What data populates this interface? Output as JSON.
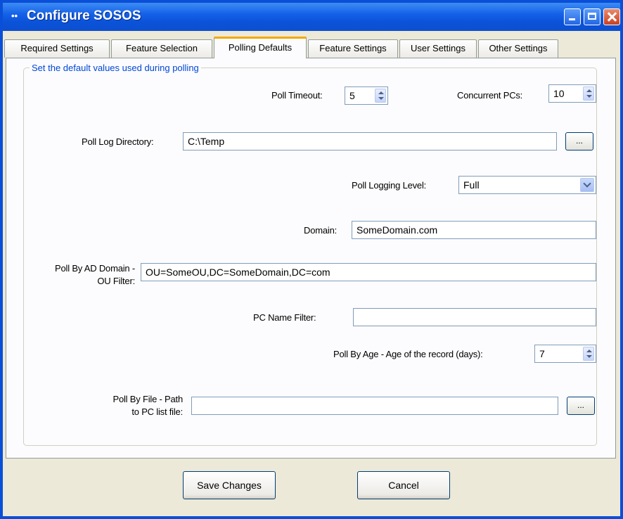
{
  "window": {
    "title": "Configure SOSOS",
    "icon": "app-icon"
  },
  "tabs": [
    {
      "label": "Required Settings"
    },
    {
      "label": "Feature Selection"
    },
    {
      "label": "Polling Defaults"
    },
    {
      "label": "Feature Settings"
    },
    {
      "label": "User Settings"
    },
    {
      "label": "Other Settings"
    }
  ],
  "active_tab": "Polling Defaults",
  "group": {
    "legend": "Set the default values used during polling"
  },
  "fields": {
    "poll_timeout": {
      "label": "Poll Timeout:",
      "value": "5"
    },
    "concurrent_pcs": {
      "label": "Concurrent PCs:",
      "value": "10"
    },
    "poll_log_directory": {
      "label": "Poll Log Directory:",
      "value": "C:\\Temp",
      "browse": "..."
    },
    "poll_logging_level": {
      "label": "Poll Logging Level:",
      "value": "Full"
    },
    "domain": {
      "label": "Domain:",
      "value": "SomeDomain.com"
    },
    "ou_filter": {
      "label_line1": "Poll By AD Domain -",
      "label_line2": "OU Filter:",
      "value": "OU=SomeOU,DC=SomeDomain,DC=com"
    },
    "pc_name_filter": {
      "label": "PC Name Filter:",
      "value": ""
    },
    "poll_by_age": {
      "label": "Poll By Age - Age of the record (days):",
      "value": "7"
    },
    "poll_by_file": {
      "label_line1": "Poll By File - Path",
      "label_line2": "to PC list file:",
      "value": "",
      "browse": "..."
    }
  },
  "buttons": {
    "save": "Save Changes",
    "cancel": "Cancel"
  },
  "colors": {
    "titlebar": "#0a52d8",
    "legend": "#0046d5",
    "active_tab_accent": "#f5a800",
    "face": "#ece9d8"
  }
}
